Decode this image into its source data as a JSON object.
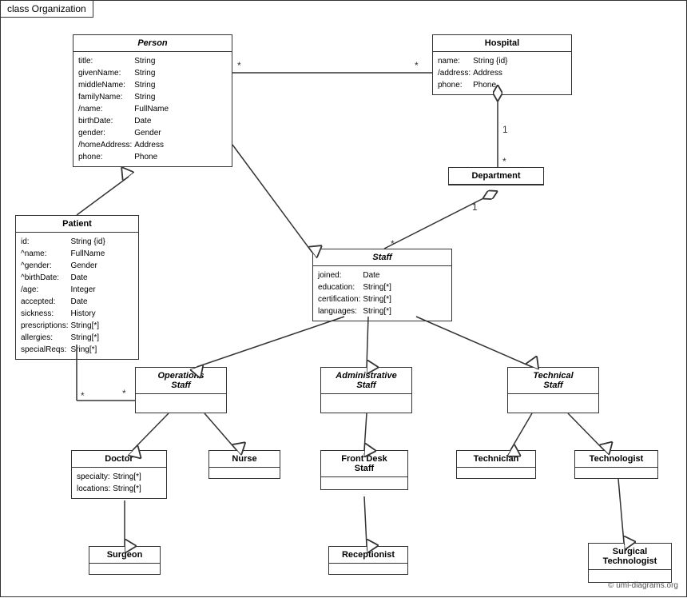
{
  "title": "class Organization",
  "classes": {
    "person": {
      "name": "Person",
      "italic": true,
      "attrs": [
        [
          "title:",
          "String"
        ],
        [
          "givenName:",
          "String"
        ],
        [
          "middleName:",
          "String"
        ],
        [
          "familyName:",
          "String"
        ],
        [
          "/name:",
          "FullName"
        ],
        [
          "birthDate:",
          "Date"
        ],
        [
          "gender:",
          "Gender"
        ],
        [
          "/homeAddress:",
          "Address"
        ],
        [
          "phone:",
          "Phone"
        ]
      ]
    },
    "hospital": {
      "name": "Hospital",
      "italic": false,
      "attrs": [
        [
          "name:",
          "String {id}"
        ],
        [
          "/address:",
          "Address"
        ],
        [
          "phone:",
          "Phone"
        ]
      ]
    },
    "department": {
      "name": "Department",
      "italic": false,
      "attrs": []
    },
    "staff": {
      "name": "Staff",
      "italic": true,
      "attrs": [
        [
          "joined:",
          "Date"
        ],
        [
          "education:",
          "String[*]"
        ],
        [
          "certification:",
          "String[*]"
        ],
        [
          "languages:",
          "String[*]"
        ]
      ]
    },
    "patient": {
      "name": "Patient",
      "italic": false,
      "attrs": [
        [
          "id:",
          "String {id}"
        ],
        [
          "^name:",
          "FullName"
        ],
        [
          "^gender:",
          "Gender"
        ],
        [
          "^birthDate:",
          "Date"
        ],
        [
          "/age:",
          "Integer"
        ],
        [
          "accepted:",
          "Date"
        ],
        [
          "sickness:",
          "History"
        ],
        [
          "prescriptions:",
          "String[*]"
        ],
        [
          "allergies:",
          "String[*]"
        ],
        [
          "specialReqs:",
          "Sring[*]"
        ]
      ]
    },
    "operations_staff": {
      "name": "Operations\nStaff",
      "italic": true,
      "attrs": []
    },
    "administrative_staff": {
      "name": "Administrative\nStaff",
      "italic": true,
      "attrs": []
    },
    "technical_staff": {
      "name": "Technical\nStaff",
      "italic": true,
      "attrs": []
    },
    "doctor": {
      "name": "Doctor",
      "italic": false,
      "attrs": [
        [
          "specialty:",
          "String[*]"
        ],
        [
          "locations:",
          "String[*]"
        ]
      ]
    },
    "nurse": {
      "name": "Nurse",
      "italic": false,
      "attrs": []
    },
    "front_desk_staff": {
      "name": "Front Desk\nStaff",
      "italic": false,
      "attrs": []
    },
    "technician": {
      "name": "Technician",
      "italic": false,
      "attrs": []
    },
    "technologist": {
      "name": "Technologist",
      "italic": false,
      "attrs": []
    },
    "surgeon": {
      "name": "Surgeon",
      "italic": false,
      "attrs": []
    },
    "receptionist": {
      "name": "Receptionist",
      "italic": false,
      "attrs": []
    },
    "surgical_technologist": {
      "name": "Surgical\nTechnologist",
      "italic": false,
      "attrs": []
    }
  },
  "copyright": "© uml-diagrams.org"
}
